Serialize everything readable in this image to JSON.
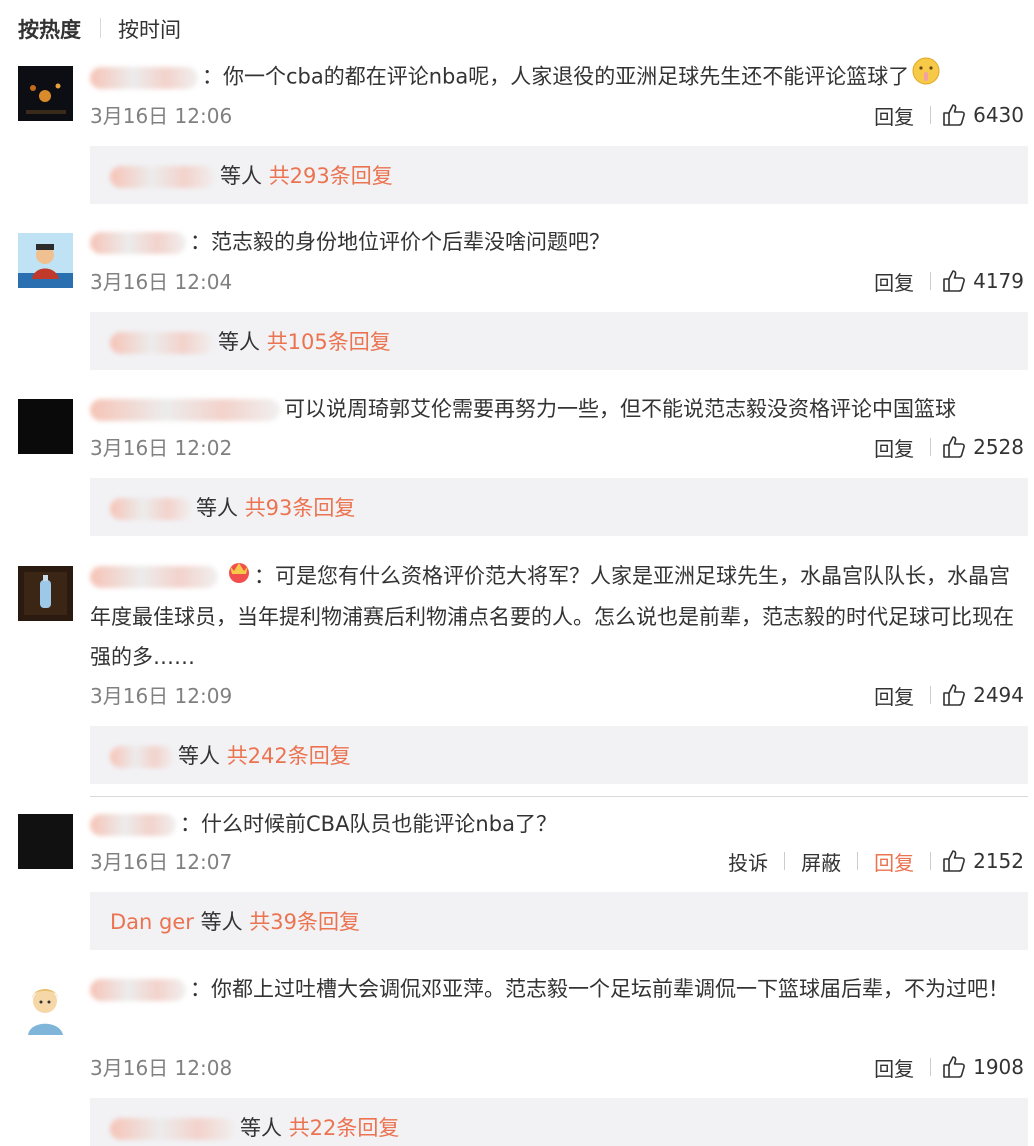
{
  "sort": {
    "hot_label": "按热度",
    "time_label": "按时间"
  },
  "comments": [
    {
      "text": "：你一个cba的都在评论nba呢，人家退役的亚洲足球先生还不能评论篮球了",
      "time": "3月16日 12:06",
      "reply_label": "回复",
      "likes": "6430",
      "reply_suffix": "等人",
      "reply_total": "共293条回复",
      "has_emoji": true
    },
    {
      "text": "：范志毅的身份地位评价个后辈没啥问题吧？",
      "time": "3月16日 12:04",
      "reply_label": "回复",
      "likes": "4179",
      "reply_suffix": "等人",
      "reply_total": "共105条回复"
    },
    {
      "text": "可以说周琦郭艾伦需要再努力一些，但不能说范志毅没资格评论中国篮球",
      "time": "3月16日 12:02",
      "reply_label": "回复",
      "likes": "2528",
      "reply_suffix": "等人",
      "reply_total": "共93条回复"
    },
    {
      "text": "：可是您有什么资格评价范大将军？人家是亚洲足球先生，水晶宫队队长，水晶宫年度最佳球员，当年提利物浦赛后利物浦点名要的人。怎么说也是前辈，范志毅的时代足球可比现在强的多……",
      "time": "3月16日 12:09",
      "reply_label": "回复",
      "likes": "2494",
      "reply_suffix": "等人",
      "reply_total": "共242条回复"
    },
    {
      "text": "：什么时候前CBA队员也能评论nba了？",
      "time": "3月16日 12:07",
      "complain_label": "投诉",
      "block_label": "屏蔽",
      "reply_label": "回复",
      "likes": "2152",
      "reply_name": "Dan ger",
      "reply_suffix": "等人",
      "reply_total": "共39条回复"
    },
    {
      "text": "：你都上过吐槽大会调侃邓亚萍。范志毅一个足坛前辈调侃一下篮球届后辈，不为过吧！",
      "time": "3月16日 12:08",
      "reply_label": "回复",
      "likes": "1908",
      "reply_suffix": "等人",
      "reply_total": "共22条回复"
    }
  ],
  "colors": {
    "accent": "#eb7350",
    "meta_gray": "#808080",
    "reply_bg": "#f2f2f5"
  }
}
